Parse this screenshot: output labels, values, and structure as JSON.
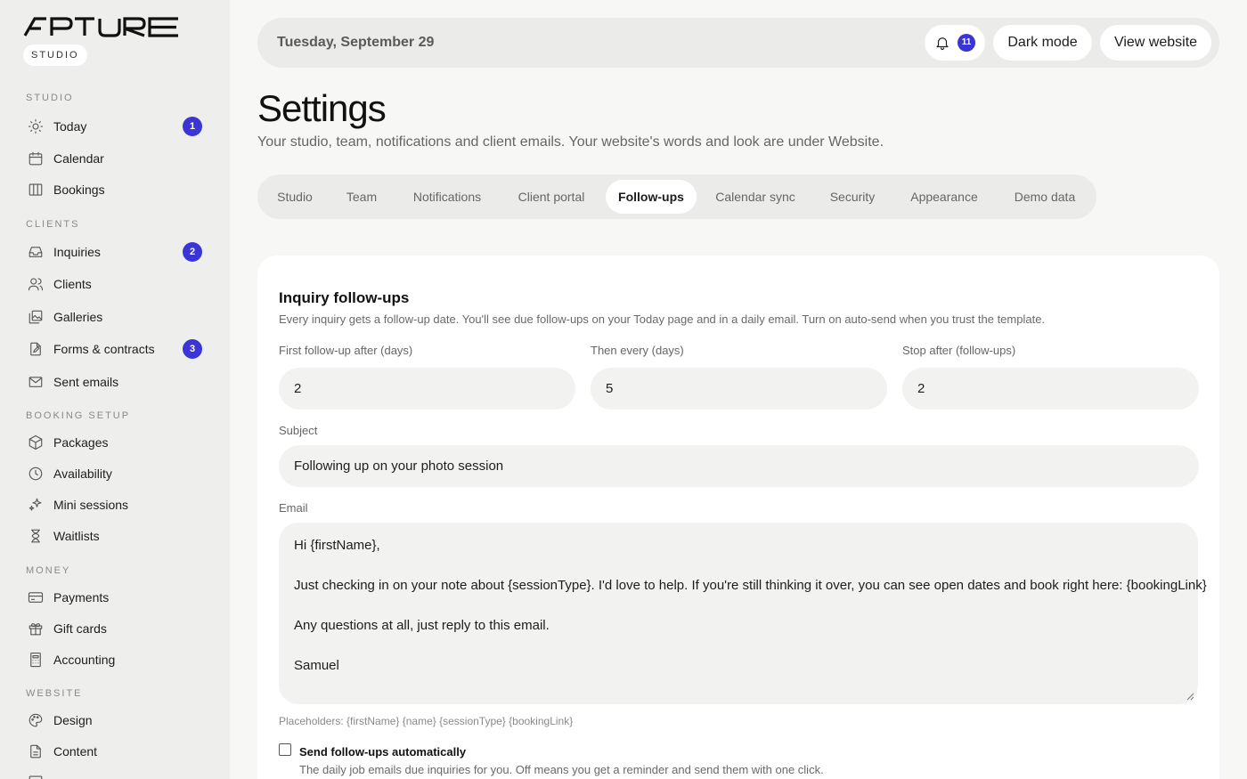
{
  "brand": {
    "logo_text": "APTURE",
    "pill": "STUDIO",
    "accent": "#3b35d6"
  },
  "sidebar": {
    "sections": [
      {
        "label": "STUDIO"
      },
      {
        "label": "CLIENTS"
      },
      {
        "label": "BOOKING SETUP"
      },
      {
        "label": "MONEY"
      },
      {
        "label": "WEBSITE"
      }
    ],
    "items": [
      {
        "label": "Today",
        "icon": "sun-icon",
        "badge": "1"
      },
      {
        "label": "Calendar",
        "icon": "calendar-icon"
      },
      {
        "label": "Bookings",
        "icon": "columns-icon"
      },
      {
        "label": "Inquiries",
        "icon": "inbox-icon",
        "badge": "2"
      },
      {
        "label": "Clients",
        "icon": "users-icon"
      },
      {
        "label": "Galleries",
        "icon": "gallery-icon"
      },
      {
        "label": "Forms & contracts",
        "icon": "document-pen-icon",
        "badge": "3"
      },
      {
        "label": "Sent emails",
        "icon": "mail-icon"
      },
      {
        "label": "Packages",
        "icon": "package-icon"
      },
      {
        "label": "Availability",
        "icon": "clock-icon"
      },
      {
        "label": "Mini sessions",
        "icon": "sparkle-icon"
      },
      {
        "label": "Waitlists",
        "icon": "hourglass-icon"
      },
      {
        "label": "Payments",
        "icon": "credit-card-icon"
      },
      {
        "label": "Gift cards",
        "icon": "gift-icon"
      },
      {
        "label": "Accounting",
        "icon": "calculator-icon"
      },
      {
        "label": "Design",
        "icon": "palette-icon"
      },
      {
        "label": "Content",
        "icon": "file-text-icon"
      }
    ]
  },
  "topbar": {
    "date": "Tuesday, September 29",
    "notifications_count": "11",
    "dark_mode_label": "Dark mode",
    "view_website_label": "View website"
  },
  "page": {
    "title": "Settings",
    "subtitle": "Your studio, team, notifications and client emails. Your website's words and look are under Website."
  },
  "tabs": [
    {
      "label": "Studio"
    },
    {
      "label": "Team"
    },
    {
      "label": "Notifications"
    },
    {
      "label": "Client portal"
    },
    {
      "label": "Follow-ups",
      "active": true
    },
    {
      "label": "Calendar sync"
    },
    {
      "label": "Security"
    },
    {
      "label": "Appearance"
    },
    {
      "label": "Demo data"
    }
  ],
  "followups": {
    "title": "Inquiry follow-ups",
    "description": "Every inquiry gets a follow-up date. You'll see due follow-ups on your Today page and in a daily email. Turn on auto-send when you trust the template.",
    "first_label": "First follow-up after (days)",
    "first_value": "2",
    "every_label": "Then every (days)",
    "every_value": "5",
    "stop_label": "Stop after (follow-ups)",
    "stop_value": "2",
    "subject_label": "Subject",
    "subject_value": "Following up on your photo session",
    "email_label": "Email",
    "email_lines": [
      "Hi {firstName},",
      "Just checking in on your note about {sessionType}. I'd love to help. If you're still thinking it over, you can see open dates and book right here: {bookingLink}",
      "Any questions at all, just reply to this email.",
      "Samuel"
    ],
    "placeholders": "Placeholders: {firstName} {name} {sessionType} {bookingLink}",
    "auto_label": "Send follow-ups automatically",
    "auto_help": "The daily job emails due inquiries for you. Off means you get a reminder and send them with one click.",
    "auto_checked": false
  }
}
